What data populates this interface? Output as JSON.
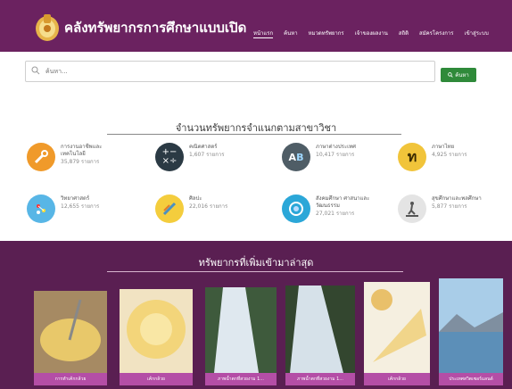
{
  "site": {
    "title": "คลังทรัพยากรการศึกษาแบบเปิด"
  },
  "nav": {
    "items": [
      {
        "label": "หน้าแรก",
        "active": true
      },
      {
        "label": "ค้นหา"
      },
      {
        "label": "หมวดทรัพยากร"
      },
      {
        "label": "เจ้าของผลงาน"
      },
      {
        "label": "สถิติ"
      },
      {
        "label": "สมัครโครงการ"
      },
      {
        "label": "เข้าสู่ระบบ"
      }
    ]
  },
  "search": {
    "placeholder": "ค้นหา...",
    "button_label": "ค้นหา"
  },
  "categories": {
    "title": "จำนวนทรัพยากรจำแนกตามสาขาวิชา",
    "items": [
      {
        "name": "การงานอาชีพและเทคโนโลยี",
        "count": "35,879 รายการ",
        "icon": "tools-icon"
      },
      {
        "name": "คณิตศาสตร์",
        "count": "1,607 รายการ",
        "icon": "math-symbols-icon"
      },
      {
        "name": "ภาษาต่างประเทศ",
        "count": "10,417 รายการ",
        "icon": "abc-icon"
      },
      {
        "name": "ภาษาไทย",
        "count": "4,925 รายการ",
        "icon": "thai-letter-icon"
      },
      {
        "name": "วิทยาศาสตร์",
        "count": "12,655 รายการ",
        "icon": "science-icon"
      },
      {
        "name": "ศิลปะ",
        "count": "22,016 รายการ",
        "icon": "art-icon"
      },
      {
        "name": "สังคมศึกษา ศาสนาและวัฒนธรรม",
        "count": "27,021 รายการ",
        "icon": "globe-icon"
      },
      {
        "name": "สุขศึกษาและพลศึกษา",
        "count": "5,877 รายการ",
        "icon": "treadmill-icon"
      }
    ]
  },
  "latest": {
    "title": "ทรัพยากรที่เพิ่มเข้ามาล่าสุด",
    "items": [
      {
        "label": "การทำเค้กกล้วย"
      },
      {
        "label": "เค้กกล้วย"
      },
      {
        "label": "ภาพน้ำตกที่สวยงาม 1..."
      },
      {
        "label": "ภาพน้ำตกที่สวยงาม 1..."
      },
      {
        "label": "เค้กกล้วย"
      },
      {
        "label": "ประเทศสวิตเซอร์แลนด์"
      }
    ]
  },
  "colors": {
    "header": "#6b2260",
    "latest_bg": "#5a1f52",
    "card_label": "#b44ea6",
    "search_button": "#2f8a3a"
  }
}
